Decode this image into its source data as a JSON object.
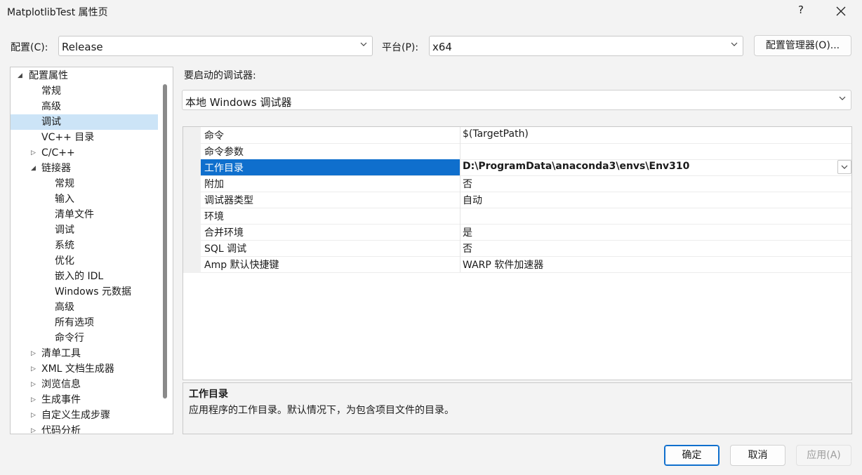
{
  "window": {
    "title": "MatplotlibTest 属性页",
    "help": "?"
  },
  "config": {
    "label": "配置(C):",
    "value": "Release"
  },
  "platform": {
    "label": "平台(P):",
    "value": "x64"
  },
  "config_manager_label": "配置管理器(O)...",
  "tree": [
    {
      "label": "配置属性",
      "expander": "expanded",
      "indent": 0
    },
    {
      "label": "常规",
      "expander": "",
      "indent": 1
    },
    {
      "label": "高级",
      "expander": "",
      "indent": 1
    },
    {
      "label": "调试",
      "expander": "",
      "indent": 1,
      "selected": true
    },
    {
      "label": "VC++ 目录",
      "expander": "",
      "indent": 1
    },
    {
      "label": "C/C++",
      "expander": "collapsed",
      "indent": 1
    },
    {
      "label": "链接器",
      "expander": "expanded",
      "indent": 1
    },
    {
      "label": "常规",
      "expander": "",
      "indent": 2
    },
    {
      "label": "输入",
      "expander": "",
      "indent": 2
    },
    {
      "label": "清单文件",
      "expander": "",
      "indent": 2
    },
    {
      "label": "调试",
      "expander": "",
      "indent": 2
    },
    {
      "label": "系统",
      "expander": "",
      "indent": 2
    },
    {
      "label": "优化",
      "expander": "",
      "indent": 2
    },
    {
      "label": "嵌入的 IDL",
      "expander": "",
      "indent": 2
    },
    {
      "label": "Windows 元数据",
      "expander": "",
      "indent": 2
    },
    {
      "label": "高级",
      "expander": "",
      "indent": 2
    },
    {
      "label": "所有选项",
      "expander": "",
      "indent": 2
    },
    {
      "label": "命令行",
      "expander": "",
      "indent": 2
    },
    {
      "label": "清单工具",
      "expander": "collapsed",
      "indent": 1
    },
    {
      "label": "XML 文档生成器",
      "expander": "collapsed",
      "indent": 1
    },
    {
      "label": "浏览信息",
      "expander": "collapsed",
      "indent": 1
    },
    {
      "label": "生成事件",
      "expander": "collapsed",
      "indent": 1
    },
    {
      "label": "自定义生成步骤",
      "expander": "collapsed",
      "indent": 1
    },
    {
      "label": "代码分析",
      "expander": "collapsed",
      "indent": 1
    }
  ],
  "debugger": {
    "label": "要启动的调试器:",
    "value": "本地 Windows 调试器"
  },
  "properties": [
    {
      "name": "命令",
      "value": "$(TargetPath)"
    },
    {
      "name": "命令参数",
      "value": ""
    },
    {
      "name": "工作目录",
      "value": "D:\\ProgramData\\anaconda3\\envs\\Env310",
      "selected": true
    },
    {
      "name": "附加",
      "value": "否"
    },
    {
      "name": "调试器类型",
      "value": "自动"
    },
    {
      "name": "环境",
      "value": ""
    },
    {
      "name": "合并环境",
      "value": "是"
    },
    {
      "name": "SQL 调试",
      "value": "否"
    },
    {
      "name": "Amp 默认快捷键",
      "value": "WARP 软件加速器"
    }
  ],
  "description": {
    "title": "工作目录",
    "text": "应用程序的工作目录。默认情况下，为包含项目文件的目录。"
  },
  "buttons": {
    "ok": "确定",
    "cancel": "取消",
    "apply": "应用(A)"
  },
  "colors": {
    "selection": "#0f6fcd",
    "tree_selection": "#cce4f7",
    "accent_border": "#0f6fcd"
  }
}
